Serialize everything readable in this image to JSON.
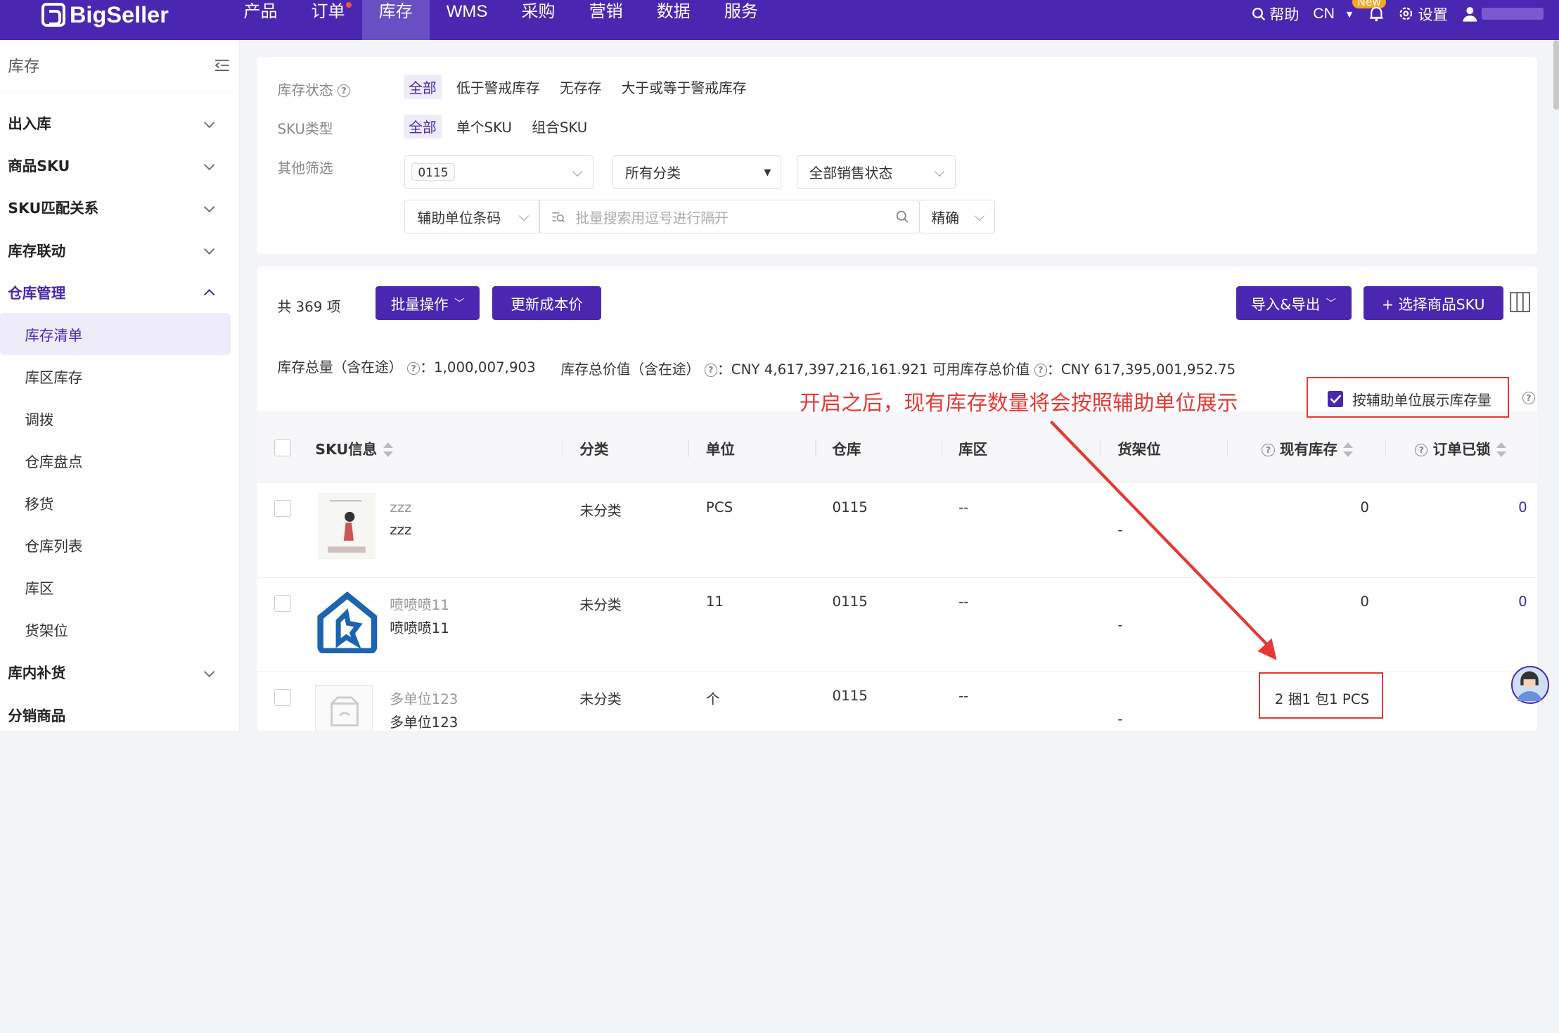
{
  "topbar": {
    "logo": "BigSeller",
    "nav": [
      {
        "label": "产品",
        "active": false,
        "dot": false
      },
      {
        "label": "订单",
        "active": false,
        "dot": true
      },
      {
        "label": "库存",
        "active": true,
        "dot": false
      },
      {
        "label": "WMS",
        "active": false,
        "dot": false
      },
      {
        "label": "采购",
        "active": false,
        "dot": false
      },
      {
        "label": "营销",
        "active": false,
        "dot": false
      },
      {
        "label": "数据",
        "active": false,
        "dot": false
      },
      {
        "label": "服务",
        "active": false,
        "dot": false
      }
    ],
    "help": "帮助",
    "lang": "CN",
    "new_badge": "New",
    "settings": "设置",
    "brand_color": "#4a27b0"
  },
  "sidebar": {
    "title": "库存",
    "items": [
      {
        "label": "出入库",
        "type": "group"
      },
      {
        "label": "商品SKU",
        "type": "group"
      },
      {
        "label": "SKU匹配关系",
        "type": "group"
      },
      {
        "label": "库存联动",
        "type": "group"
      },
      {
        "label": "仓库管理",
        "type": "group-open"
      },
      {
        "label": "库存清单",
        "type": "sub-active"
      },
      {
        "label": "库区库存",
        "type": "sub"
      },
      {
        "label": "调拨",
        "type": "sub"
      },
      {
        "label": "仓库盘点",
        "type": "sub"
      },
      {
        "label": "移货",
        "type": "sub"
      },
      {
        "label": "仓库列表",
        "type": "sub"
      },
      {
        "label": "库区",
        "type": "sub"
      },
      {
        "label": "货架位",
        "type": "sub"
      },
      {
        "label": "库内补货",
        "type": "group"
      },
      {
        "label": "分销商品",
        "type": "group"
      }
    ]
  },
  "filters": {
    "stock_status": {
      "label": "库存状态",
      "options": [
        "全部",
        "低于警戒库存",
        "无存存",
        "大于或等于警戒库存"
      ],
      "selected": 0
    },
    "sku_type": {
      "label": "SKU类型",
      "options": [
        "全部",
        "单个SKU",
        "组合SKU"
      ],
      "selected": 0
    },
    "other_label": "其他筛选",
    "warehouse_tag": "0115",
    "category": "所有分类",
    "sale_status": "全部销售状态",
    "search_field": "辅助单位条码",
    "search_placeholder": "批量搜索用逗号进行隔开",
    "match_mode": "精确"
  },
  "toolbar": {
    "count": "共 369 项",
    "batch": "批量操作",
    "update_cost": "更新成本价",
    "import_export": "导入&导出",
    "select_sku": "+ 选择商品SKU"
  },
  "summary": {
    "total_qty_label": "库存总量（含在途）",
    "total_qty": "1,000,007,903",
    "total_value_label": "库存总价值（含在途）",
    "total_value": "CNY 4,617,397,216,161.921",
    "avail_value_label": "可用库存总价值",
    "avail_value": "CNY 617,395,001,952.75"
  },
  "aux_toggle": {
    "label": "按辅助单位展示库存量",
    "checked": true
  },
  "annotation": "开启之后，现有库存数量将会按照辅助单位展示",
  "table": {
    "headers": [
      "SKU信息",
      "分类",
      "单位",
      "仓库",
      "库区",
      "货架位",
      "现有库存",
      "订单已锁"
    ],
    "rows": [
      {
        "sku_gray": "zzz",
        "sku": "zzz",
        "category": "未分类",
        "unit": "PCS",
        "warehouse": "0115",
        "zone": "--",
        "shelf": "-",
        "stock": "0",
        "locked": "0"
      },
      {
        "sku_gray": "喷喷喷11",
        "sku": "喷喷喷11",
        "category": "未分类",
        "unit": "11",
        "warehouse": "0115",
        "zone": "--",
        "shelf": "-",
        "stock": "0",
        "locked": "0"
      },
      {
        "sku_gray": "多单位123",
        "sku": "多单位123",
        "category": "未分类",
        "unit": "个",
        "warehouse": "0115",
        "zone": "--",
        "shelf": "-",
        "stock": "2 捆1 包1 PCS",
        "locked": ""
      }
    ]
  }
}
